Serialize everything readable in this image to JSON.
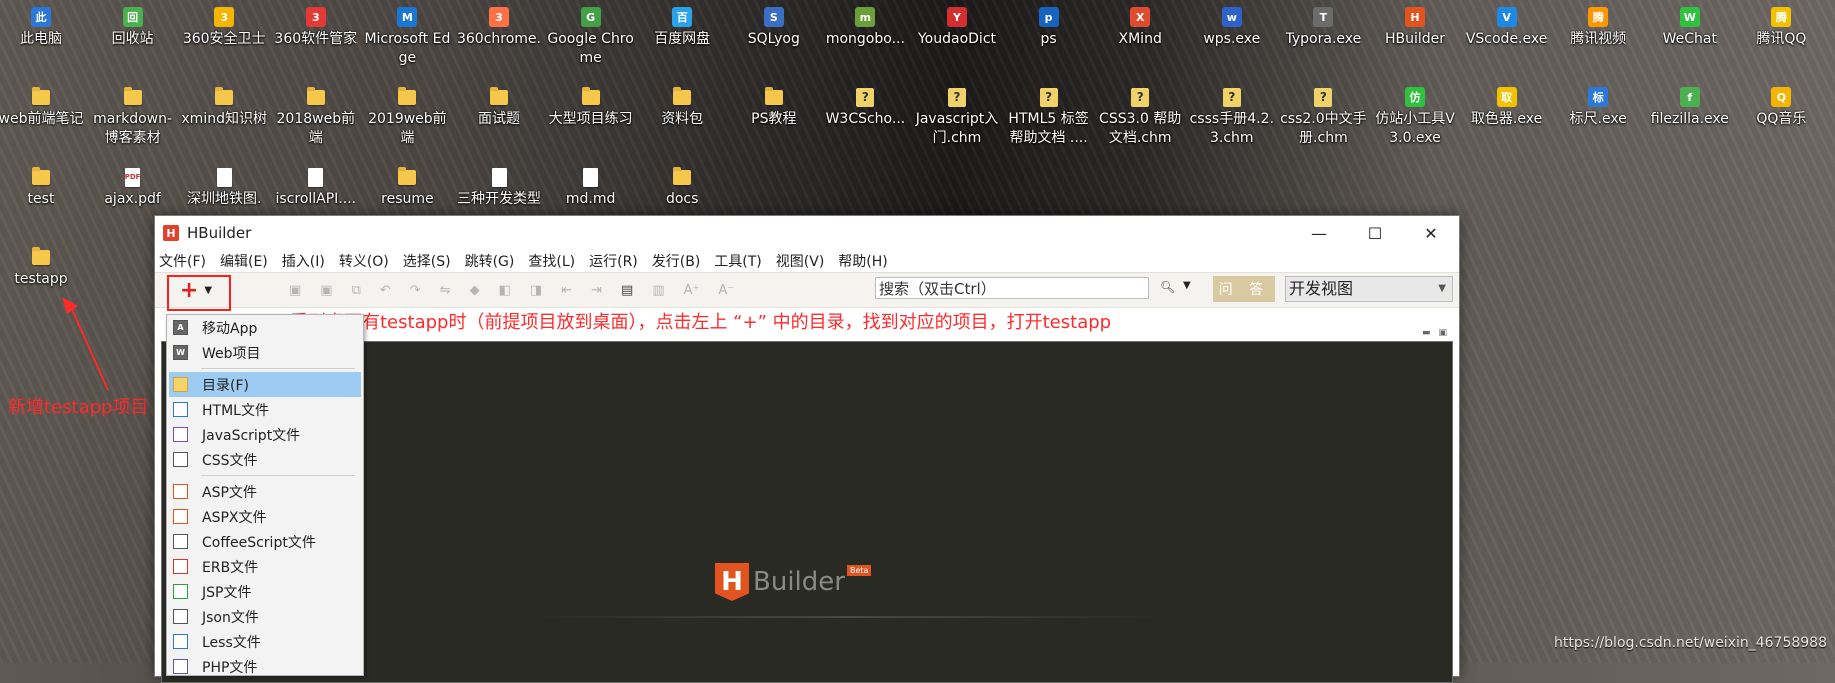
{
  "desktop": {
    "row1": [
      "此电脑",
      "回收站",
      "360安全卫士",
      "360软件管家",
      "Microsoft Edge",
      "360chrome.",
      "Google Chrome",
      "百度网盘",
      "SQLyog",
      "mongobo...",
      "YoudaoDict",
      "ps",
      "XMind",
      "wps.exe",
      "Typora.exe",
      "HBuilder",
      "VScode.exe",
      "腾讯视频",
      "WeChat",
      "腾讯QQ"
    ],
    "row2": [
      "web前端笔记",
      "markdown-博客素材",
      "xmind知识树",
      "2018web前端",
      "2019web前端",
      "面试题",
      "大型项目练习",
      "资料包",
      "PS教程",
      "W3CScho...",
      "Javascript入门.chm",
      "HTML5 标签帮助文档 ....",
      "CSS3.0 帮助文档.chm",
      "csss手册4.2.3.chm",
      "css2.0中文手册.chm",
      "仿站小工具V3.0.exe",
      "取色器.exe",
      "标尺.exe",
      "filezilla.exe",
      "QQ音乐"
    ],
    "row3": [
      "test",
      "ajax.pdf",
      "深圳地铁图.",
      "iscrollAPI....",
      "resume",
      "三种开发类型",
      "md.md",
      "docs"
    ],
    "row4": [
      "testapp"
    ]
  },
  "annotations": {
    "left_note": "新增testapp项目",
    "main_note": "看到桌面有testapp时（前提项目放到桌面），点击左上 “+” 中的目录，找到对应的项目，打开testapp",
    "color": "#ff2a2a"
  },
  "window": {
    "title": "HBuilder",
    "menu": [
      "文件(F)",
      "编辑(E)",
      "插入(I)",
      "转义(O)",
      "选择(S)",
      "跳转(G)",
      "查找(L)",
      "运行(R)",
      "发行(B)",
      "工具(T)",
      "视图(V)",
      "帮助(H)"
    ],
    "new_button": "+",
    "search_placeholder": "搜索（双击Ctrl）",
    "ask_button": "问 答",
    "view_select": "开发视图",
    "brand_word": "Builder",
    "brand_beta": "Beta"
  },
  "new_menu": {
    "items": [
      {
        "label": "移动App",
        "icon": "A"
      },
      {
        "label": "Web项目",
        "icon": "W"
      },
      {
        "sep": true
      },
      {
        "label": "目录(F)",
        "icon": "folder",
        "selected": true
      },
      {
        "label": "HTML文件",
        "icon": "<>"
      },
      {
        "label": "JavaScript文件",
        "icon": "JS"
      },
      {
        "label": "CSS文件",
        "icon": "{}"
      },
      {
        "sep": true
      },
      {
        "label": "ASP文件",
        "icon": "ASP"
      },
      {
        "label": "ASPX文件",
        "icon": "ASP"
      },
      {
        "label": "CoffeeScript文件",
        "icon": "≡"
      },
      {
        "label": "ERB文件",
        "icon": "ERB"
      },
      {
        "label": "JSP文件",
        "icon": "JSP"
      },
      {
        "label": "Json文件",
        "icon": "{}"
      },
      {
        "label": "Less文件",
        "icon": "L"
      },
      {
        "label": "PHP文件",
        "icon": "PHP"
      }
    ]
  },
  "watermark": "https://blog.csdn.net/weixin_46758988"
}
